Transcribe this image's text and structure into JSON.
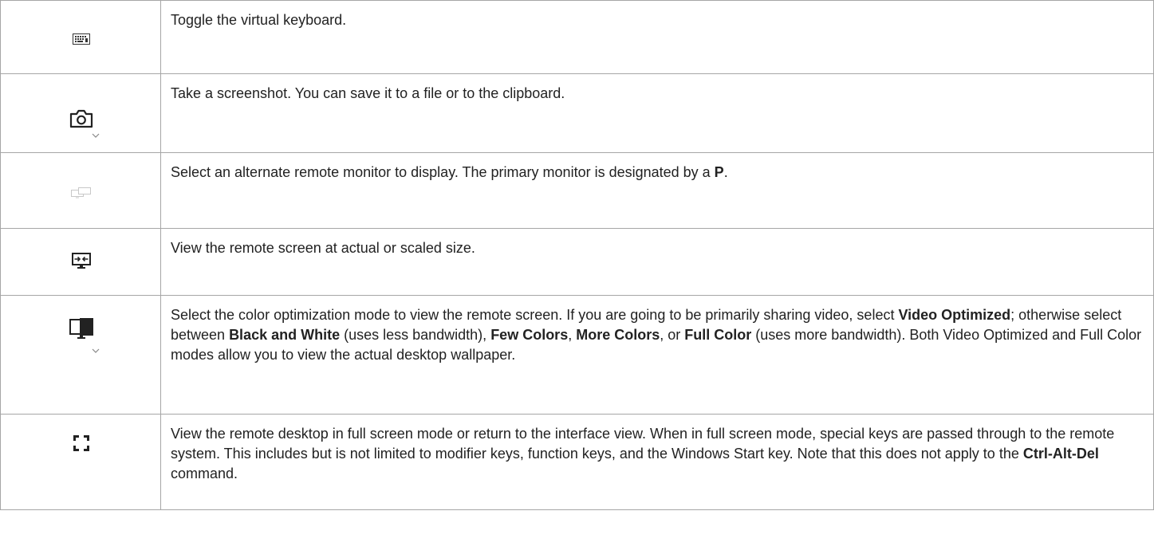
{
  "rows": [
    {
      "icon": "keyboard-icon",
      "parts": [
        {
          "t": "Toggle the virtual keyboard."
        }
      ]
    },
    {
      "icon": "camera-icon",
      "dropdown": true,
      "parts": [
        {
          "t": "Take a screenshot. You can save it to a file or to the clipboard."
        }
      ]
    },
    {
      "icon": "monitors-icon",
      "parts": [
        {
          "t": "Select an alternate remote monitor to display. The primary monitor is designated by a "
        },
        {
          "t": "P",
          "b": true
        },
        {
          "t": "."
        }
      ]
    },
    {
      "icon": "scale-screen-icon",
      "parts": [
        {
          "t": "View the remote screen at actual or scaled size."
        }
      ]
    },
    {
      "icon": "color-mode-icon",
      "dropdown": true,
      "parts": [
        {
          "t": "Select the color optimization mode to view the remote screen. If you are going to be primarily sharing video, select "
        },
        {
          "t": "Video Optimized",
          "b": true
        },
        {
          "t": "; otherwise select between "
        },
        {
          "t": "Black and White",
          "b": true
        },
        {
          "t": " (uses less bandwidth), "
        },
        {
          "t": "Few Colors",
          "b": true
        },
        {
          "t": ", "
        },
        {
          "t": "More Colors",
          "b": true
        },
        {
          "t": ", or "
        },
        {
          "t": "Full Color",
          "b": true
        },
        {
          "t": " (uses more bandwidth). Both Video Optimized and Full Color modes allow you to view the actual desktop wallpaper."
        }
      ]
    },
    {
      "icon": "fullscreen-icon",
      "parts": [
        {
          "t": "View the remote desktop in full screen mode or return to the interface view. When in full screen mode, special keys are passed through to the remote system. This includes but is not limited to modifier keys, function keys, and the Windows Start key. Note that this does not apply to the "
        },
        {
          "t": "Ctrl-Alt-Del",
          "b": true
        },
        {
          "t": " command."
        }
      ]
    }
  ]
}
